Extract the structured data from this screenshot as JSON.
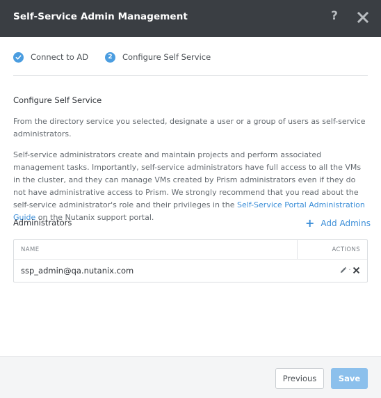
{
  "modal": {
    "title": "Self-Service Admin Management",
    "help_glyph": "?",
    "icons": {
      "help": "help-icon",
      "close": "close-icon"
    }
  },
  "steps": [
    {
      "label": "Connect to AD",
      "state": "complete",
      "marker": "check-icon"
    },
    {
      "label": "Configure Self Service",
      "state": "current",
      "marker": "2"
    }
  ],
  "section": {
    "title": "Configure Self Service",
    "paragraph1": "From the directory service you selected, designate a user or a group of users as self-service administrators.",
    "paragraph2_before": "Self-service administrators create and maintain projects and perform associated management tasks. Importantly, self-service administrators have full access to all the VMs in the cluster, and they can manage VMs created by Prism administrators even if they do not have administrative access to Prism. We strongly recommend that you read about the self-service administrator's role and their privileges in the ",
    "paragraph2_link": "Self-Service Portal Administration Guide",
    "paragraph2_after": " on the Nutanix support portal."
  },
  "administrators": {
    "label": "Administrators",
    "add_button": "Add Admins",
    "add_glyph": "+",
    "columns": {
      "name": "NAME",
      "actions": "ACTIONS"
    },
    "rows": [
      {
        "name": "ssp_admin@qa.nutanix.com",
        "separator": "·",
        "actions": [
          "pencil-icon",
          "delete-icon"
        ]
      }
    ]
  },
  "footer": {
    "previous": "Previous",
    "save": "Save"
  },
  "colors": {
    "header_bg": "#3a3e43",
    "accent": "#4b9de0",
    "link": "#3b8ed8",
    "save_button": "#8cc0ec",
    "footer_bg": "#f4f5f6"
  }
}
